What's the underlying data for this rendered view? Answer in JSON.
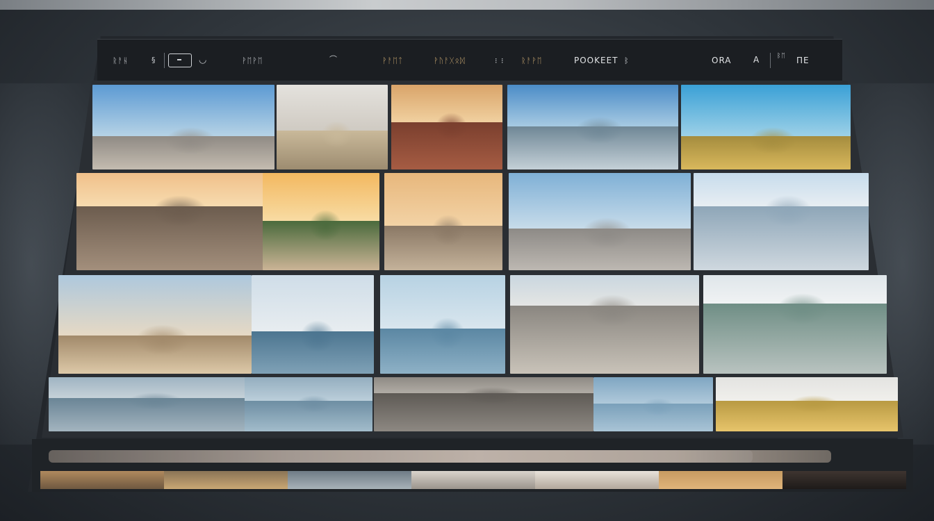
{
  "toolbar": {
    "left_label": "ᚱᚨᚺ",
    "left_glyph": "§",
    "box_label": "",
    "left_icon_glyph": "◡",
    "menu_item_1": "ᚹᛖᚹᛖ",
    "center_glyph": "⌒",
    "tab_1": "ᚹᚨᛖᛏ",
    "tab_2": "ᚹᚢᚨᚷᛟᛞ",
    "tab_sep": "⁝ ⁝",
    "tab_3": "ᚱᚨᚹᛖ",
    "title": "POOKEET",
    "title_suffix": "ᛒ",
    "right_label": "ORA",
    "right_icon": "A",
    "right_badge": "ᛒᛖ",
    "right_end": "ΠΕ"
  },
  "gallery": {
    "rows": 4,
    "tiles": [
      {
        "scene": "sky-beach"
      },
      {
        "scene": "white-path"
      },
      {
        "scene": "interior-sofa"
      },
      {
        "scene": "lake-trees"
      },
      {
        "scene": "meadow-sky"
      },
      {
        "scene": "sunset-rocks"
      },
      {
        "scene": "sunset-sea"
      },
      {
        "scene": "sunset-shore"
      },
      {
        "scene": "leather-bag-post"
      },
      {
        "scene": "waterfall-fruit"
      },
      {
        "scene": "coast-grass"
      },
      {
        "scene": "sea-rock"
      },
      {
        "scene": "calm-sea-ship"
      },
      {
        "scene": "dunes-grass"
      },
      {
        "scene": "wave-grass"
      },
      {
        "scene": "sea-figure"
      },
      {
        "scene": "calm-water"
      },
      {
        "scene": "stone-object"
      },
      {
        "scene": "blue-water"
      },
      {
        "scene": "golden-field"
      }
    ]
  },
  "scrubber": {
    "progress": 0.9
  },
  "colors": {
    "accent": "#c9a770",
    "toolbar_bg": "#1b1e22",
    "frame_bg": "#23272c"
  }
}
